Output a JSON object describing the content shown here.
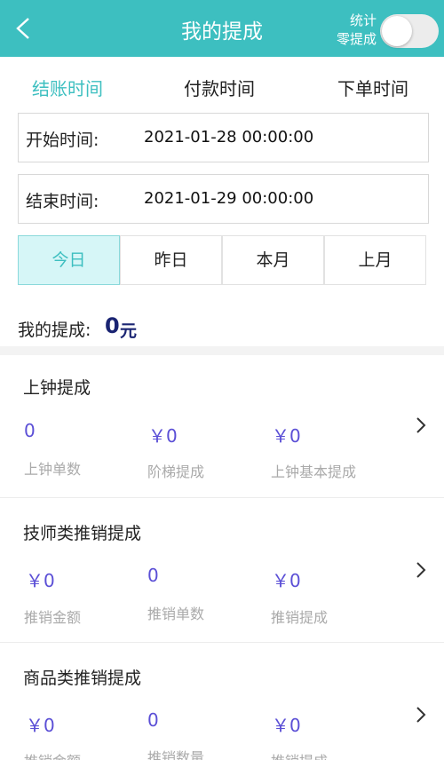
{
  "header": {
    "title": "我的提成",
    "toggle_label_line1": "统计",
    "toggle_label_line2": "零提成",
    "toggle_on": false,
    "color": "#3dbfc0"
  },
  "tabs": [
    {
      "label": "结账时间",
      "active": true
    },
    {
      "label": "付款时间",
      "active": false
    },
    {
      "label": "下单时间",
      "active": false
    }
  ],
  "start_field": {
    "label": "开始时间:",
    "value": "2021-01-28 00:00:00"
  },
  "end_field": {
    "label": "结束时间:",
    "value": "2021-01-29 00:00:00"
  },
  "quick_ranges": [
    {
      "label": "今日",
      "active": true
    },
    {
      "label": "昨日",
      "active": false
    },
    {
      "label": "本月",
      "active": false
    },
    {
      "label": "上月",
      "active": false
    }
  ],
  "total": {
    "label": "我的提成:",
    "value": "0",
    "unit": "元"
  },
  "sections": [
    {
      "title": "上钟提成",
      "stats": [
        {
          "value": "0",
          "caption": "上钟单数"
        },
        {
          "value": "￥0",
          "caption": "阶梯提成"
        },
        {
          "value": "￥0",
          "caption": "上钟基本提成"
        }
      ]
    },
    {
      "title": "技师类推销提成",
      "stats": [
        {
          "value": "￥0",
          "caption": "推销金额"
        },
        {
          "value": "0",
          "caption": "推销单数"
        },
        {
          "value": "￥0",
          "caption": "推销提成"
        }
      ]
    },
    {
      "title": "商品类推销提成",
      "stats": [
        {
          "value": "￥0",
          "caption": "推销金额"
        },
        {
          "value": "0",
          "caption": "推销数量"
        },
        {
          "value": "￥0",
          "caption": "推销提成"
        }
      ]
    }
  ]
}
